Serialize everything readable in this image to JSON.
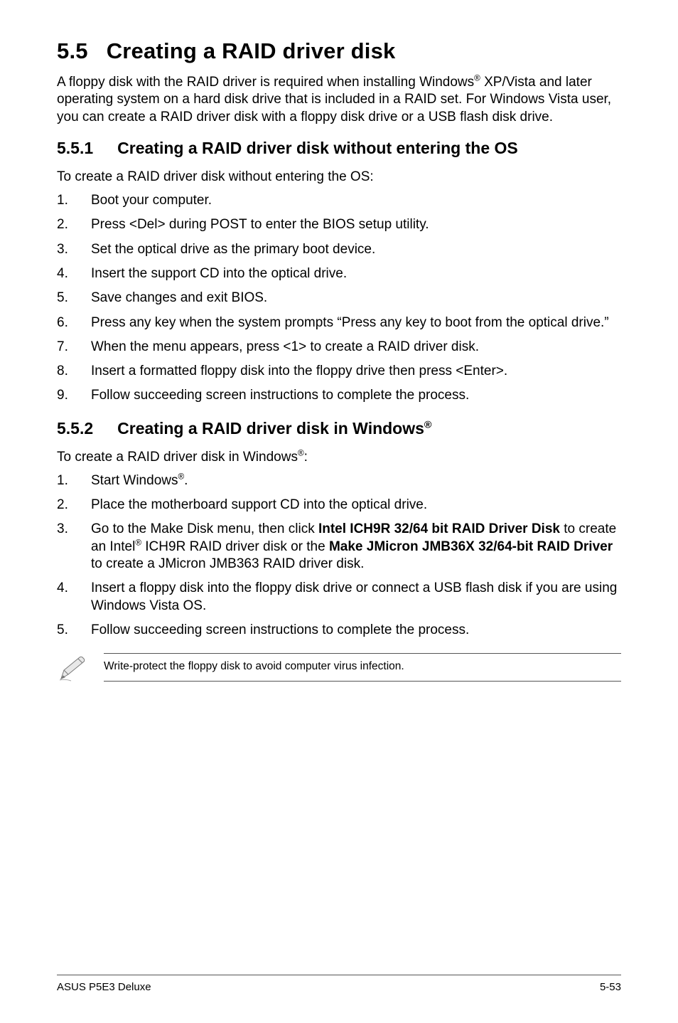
{
  "heading": {
    "number": "5.5",
    "title": "Creating a RAID driver disk"
  },
  "intro_parts": {
    "p1": "A floppy disk with the RAID driver is required when installing Windows",
    "p2": " XP/Vista and later operating system on a hard disk drive that is included in a RAID set. For Windows Vista user, you can create a RAID driver disk with a floppy disk drive or a USB flash disk drive."
  },
  "section1": {
    "number": "5.5.1",
    "title": "Creating a RAID driver disk without entering the OS",
    "lead": "To create a RAID driver disk without entering the OS:",
    "steps": [
      "Boot your computer.",
      "Press <Del> during POST to enter the BIOS setup utility.",
      "Set the optical drive as the primary boot device.",
      "Insert the support CD into the optical drive.",
      "Save changes and exit BIOS.",
      "Press any key when the system prompts “Press any key to boot from the optical drive.”",
      "When the menu appears, press <1> to create a RAID driver disk.",
      "Insert a formatted floppy disk into the floppy drive then press <Enter>.",
      "Follow succeeding screen instructions to complete the process."
    ]
  },
  "section2": {
    "number": "5.5.2",
    "title_pre": "Creating a RAID driver disk in Windows",
    "lead_pre": "To create a RAID driver disk in Windows",
    "lead_post": ":",
    "step1_pre": "Start Windows",
    "step1_post": ".",
    "step2": "Place the motherboard support CD into the optical drive.",
    "step3": {
      "a": "Go to the Make Disk menu, then click ",
      "b_bold": "Intel ICH9R 32/64 bit RAID Driver Disk",
      "c": " to create an Intel",
      "d": " ICH9R RAID driver disk or the ",
      "e_bold": "Make JMicron JMB36X 32/64-bit RAID Driver",
      "f": " to create a JMicron JMB363 RAID driver disk."
    },
    "step4": "Insert a floppy disk into the floppy disk drive or connect a USB flash disk if you are using Windows Vista OS.",
    "step5": "Follow succeeding screen instructions to complete the process."
  },
  "note": "Write-protect the floppy disk to avoid computer virus infection.",
  "footer": {
    "left": "ASUS P5E3 Deluxe",
    "right": "5-53"
  },
  "reg_mark": "®"
}
